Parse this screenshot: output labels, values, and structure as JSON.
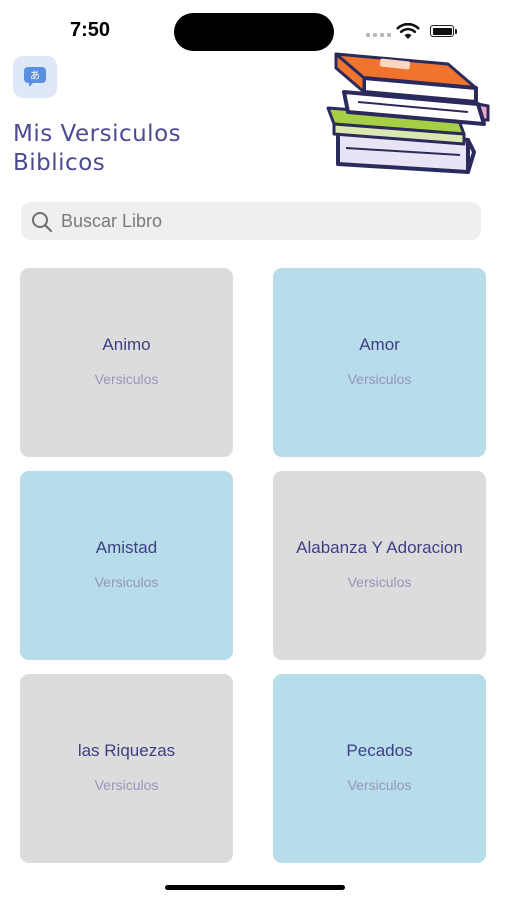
{
  "status_bar": {
    "time": "7:50"
  },
  "header": {
    "title_line1": "Mis Versiculos",
    "title_line2": "Biblicos",
    "app_icon": "translate-icon",
    "illustration": "stacked-books"
  },
  "search": {
    "placeholder": "Buscar Libro",
    "value": ""
  },
  "categories": [
    {
      "title": "Animo",
      "subtitle": "Versiculos",
      "color": "#dcdcdc"
    },
    {
      "title": "Amor",
      "subtitle": "Versiculos",
      "color": "#b7dcea"
    },
    {
      "title": "Amistad",
      "subtitle": "Versiculos",
      "color": "#b7dcea"
    },
    {
      "title": "Alabanza Y Adoracion",
      "subtitle": "Versiculos",
      "color": "#dcdcdc"
    },
    {
      "title": "las Riquezas",
      "subtitle": "Versiculos",
      "color": "#dcdcdc"
    },
    {
      "title": "Pecados",
      "subtitle": "Versiculos",
      "color": "#b7dcea"
    }
  ],
  "colors": {
    "title": "#4b4a93",
    "card_gray": "#dcdcdc",
    "card_blue": "#b7dcea",
    "subtitle": "#9695bb"
  }
}
